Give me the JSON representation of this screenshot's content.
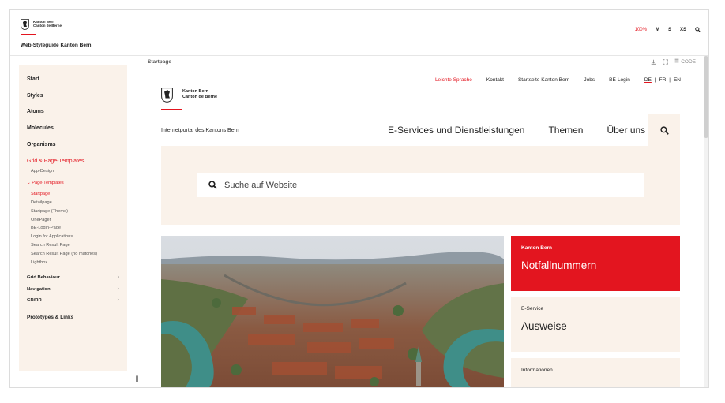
{
  "header": {
    "logo_line1": "Kanton Bern",
    "logo_line2": "Canton de Berne",
    "title": "Web-Styleguide Kanton Bern",
    "tools": [
      "100%",
      "M",
      "S",
      "XS"
    ],
    "search_icon": "search-icon"
  },
  "nav": {
    "start": "Start",
    "styles": "Styles",
    "atoms": "Atoms",
    "molecules": "Molecules",
    "organisms": "Organisms",
    "grid_templates": "Grid & Page-Templates",
    "app_design": "App-Design",
    "page_templates": "Page-Templates",
    "sub": [
      "Startpage",
      "Detailpage",
      "Startpage (Theme)",
      "OnePager",
      "BE-Login-Page",
      "Login for Applications",
      "Search Result Page",
      "Search Result Page (no matches)",
      "Lightbox"
    ],
    "grid_behaviour": "Grid Behaviour",
    "navigation": "Navigation",
    "grrr": "GR/RR",
    "prototypes": "Prototypes & Links",
    "arrow": "›",
    "caret": "⌄"
  },
  "preview": {
    "title": "Startpage",
    "code_label": "CODE"
  },
  "inner": {
    "links": [
      "Leichte Sprache",
      "Kontakt",
      "Startseite Kanton Bern",
      "Jobs",
      "BE-Login"
    ],
    "langs": [
      "DE",
      "|",
      "FR",
      "|",
      "EN"
    ],
    "logo_line1": "Kanton Bern",
    "logo_line2": "Canton de Berne",
    "portal": "Internetportal des Kantons Bern",
    "mainnav": [
      "E-Services und Dienstleistungen",
      "Themen",
      "Über uns"
    ],
    "search_placeholder": "Suche auf Website",
    "cards": [
      {
        "kicker": "Kanton Bern",
        "title": "Notfallnummern"
      },
      {
        "kicker": "E-Service",
        "title": "Ausweise"
      },
      {
        "kicker": "Informationen",
        "title": ""
      }
    ]
  },
  "colors": {
    "accent": "#e3151f",
    "beige": "#faf2ea"
  }
}
